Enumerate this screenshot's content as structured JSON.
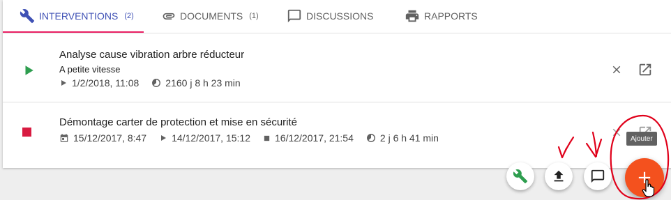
{
  "tabs": [
    {
      "label": "Interventions",
      "count": "(2)",
      "icon": "wrench-icon",
      "active": true
    },
    {
      "label": "Documents",
      "count": "(1)",
      "icon": "paperclip-icon",
      "active": false
    },
    {
      "label": "Discussions",
      "count": "",
      "icon": "comment-icon",
      "active": false
    },
    {
      "label": "Rapports",
      "count": "",
      "icon": "printer-icon",
      "active": false
    }
  ],
  "interventions": [
    {
      "status": "play",
      "status_color": "#2e9e4f",
      "title": "Analyse cause vibration arbre réducteur",
      "subtitle": "A petite vitesse",
      "start": "1/2/2018, 11:08",
      "duration": "2160 j  8 h  23 min"
    },
    {
      "status": "stop",
      "status_color": "#d81b41",
      "title": "Démontage carter de protection et mise en sécurité",
      "date_planned": "15/12/2017, 8:47",
      "start": "14/12/2017, 15:12",
      "end": "16/12/2017, 21:54",
      "duration": "2 j  6 h  41 min"
    }
  ],
  "actions": {
    "add_tooltip": "Ajouter",
    "add_label": "+"
  },
  "colors": {
    "accent": "#3f51b5",
    "indicator": "#e91e63",
    "fab": "#f4511e",
    "wrench_green": "#2e9e4f"
  }
}
